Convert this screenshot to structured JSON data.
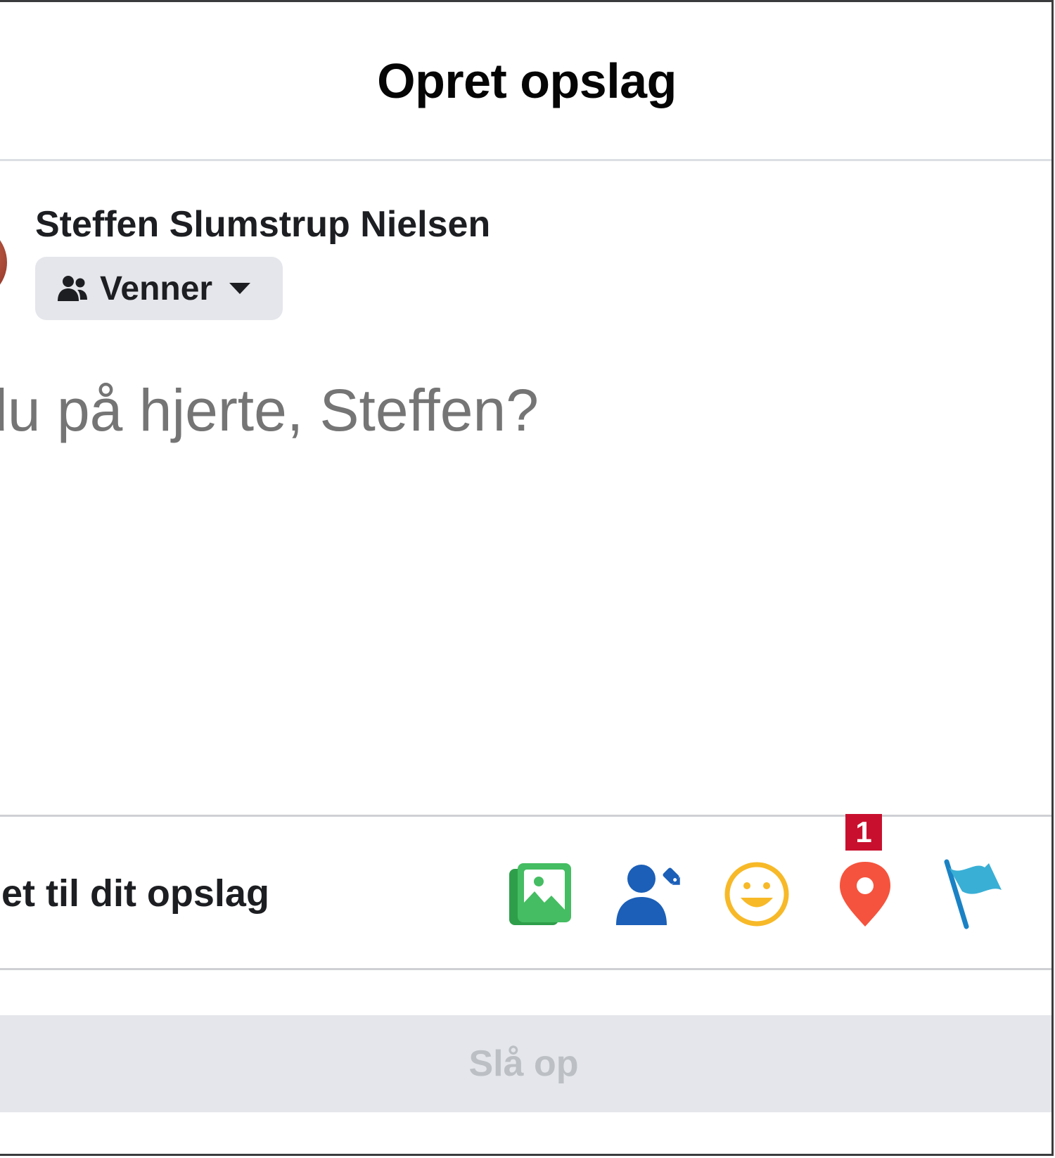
{
  "dialog": {
    "title": "Opret opslag"
  },
  "user": {
    "name": "Steffen Slumstrup Nielsen"
  },
  "audience": {
    "label": "Venner",
    "icon": "friends-icon"
  },
  "composer": {
    "placeholder": "Hvad har du på hjerte, Steffen?"
  },
  "add_to_post": {
    "label": "Tilføj noget til dit opslag",
    "icons": [
      {
        "name": "photo-video-icon",
        "color": "#45bd62"
      },
      {
        "name": "tag-people-icon",
        "color": "#1877f2"
      },
      {
        "name": "feeling-activity-icon",
        "color": "#f7b928"
      },
      {
        "name": "check-in-icon",
        "color": "#f5533d"
      },
      {
        "name": "life-event-icon",
        "color": "#39afd5"
      }
    ],
    "annotation_badge": "1"
  },
  "post_button": {
    "label": "Slå op"
  }
}
